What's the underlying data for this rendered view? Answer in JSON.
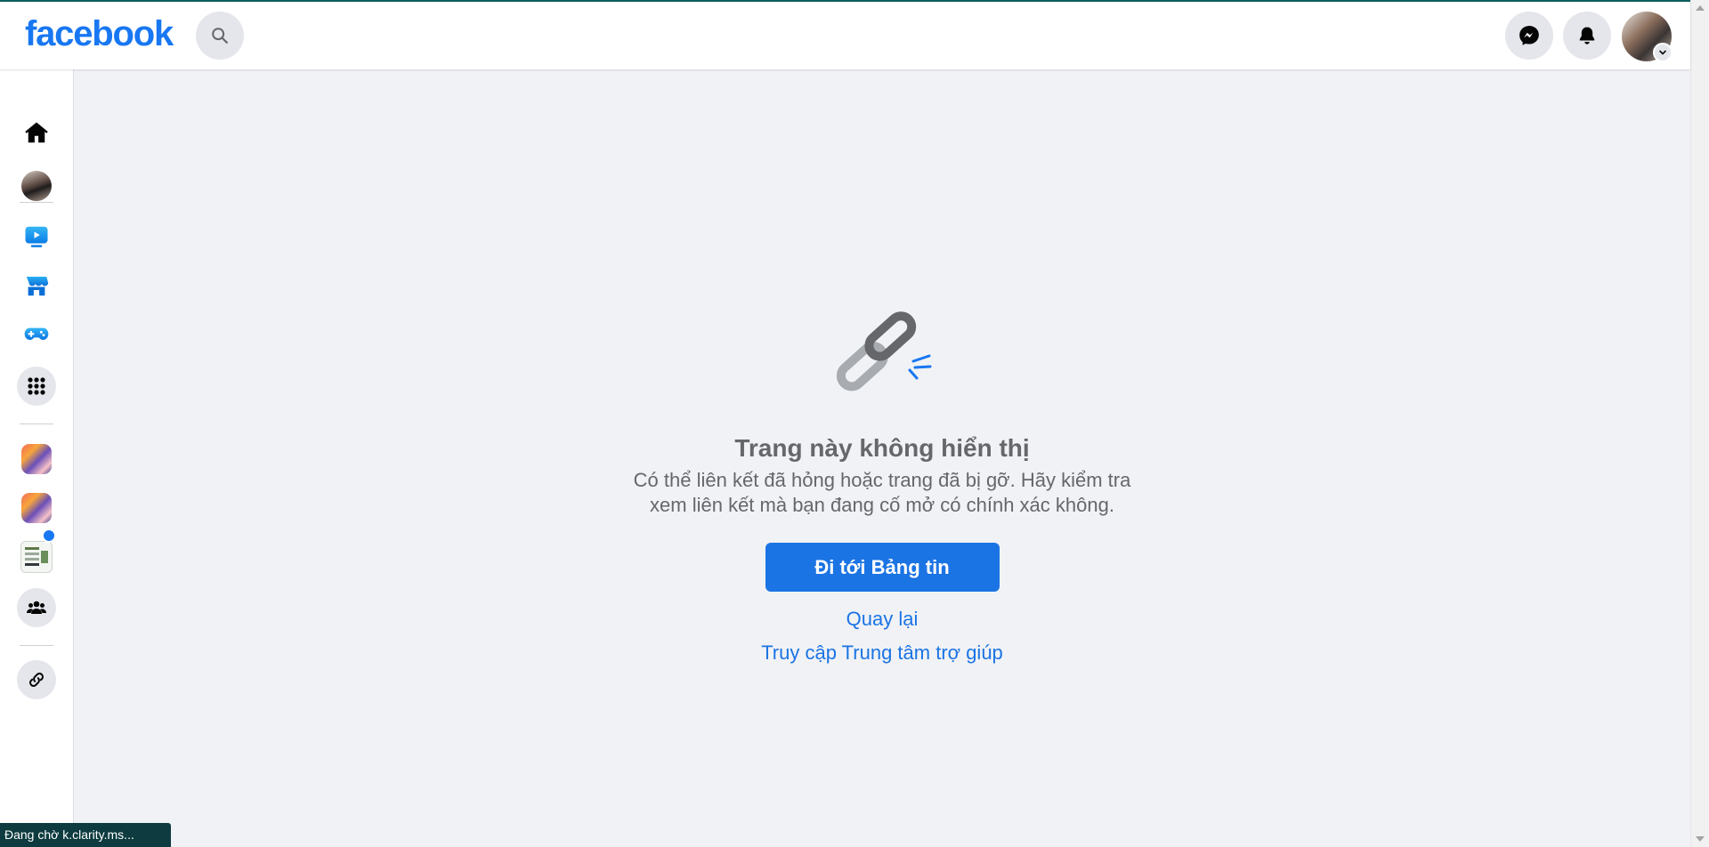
{
  "header": {
    "logo_text": "facebook",
    "icons": [
      "search-icon",
      "messenger-icon",
      "bell-icon",
      "avatar",
      "chevron-down-icon"
    ]
  },
  "sidebar": {
    "items": [
      {
        "name": "home",
        "icon": "home-icon"
      },
      {
        "name": "profile",
        "icon": "avatar"
      },
      {
        "name": "watch",
        "icon": "video-icon"
      },
      {
        "name": "marketplace",
        "icon": "store-icon"
      },
      {
        "name": "gaming",
        "icon": "gamepad-icon"
      },
      {
        "name": "all-menu",
        "icon": "grid-icon"
      },
      {
        "name": "page-1",
        "icon": "page-thumbnail"
      },
      {
        "name": "page-2",
        "icon": "page-thumbnail"
      },
      {
        "name": "page-3",
        "icon": "page-thumbnail",
        "badge": "dot"
      },
      {
        "name": "groups",
        "icon": "group-icon"
      },
      {
        "name": "link",
        "icon": "link-icon"
      }
    ]
  },
  "main": {
    "title": "Trang này không hiển thị",
    "message_line1": "Có thể liên kết đã hỏng hoặc trang đã bị gỡ. Hãy kiểm tra",
    "message_line2": "xem liên kết mà bạn đang cố mở có chính xác không.",
    "primary_button": "Đi tới Bảng tin",
    "back_link": "Quay lại",
    "help_link": "Truy cập Trung tâm trợ giúp"
  },
  "status_bar": {
    "text": "Đang chờ k.clarity.ms..."
  },
  "colors": {
    "brand": "#1877f2",
    "button": "#1b74e4",
    "background": "#f0f2f5",
    "muted_text": "#65676b"
  }
}
